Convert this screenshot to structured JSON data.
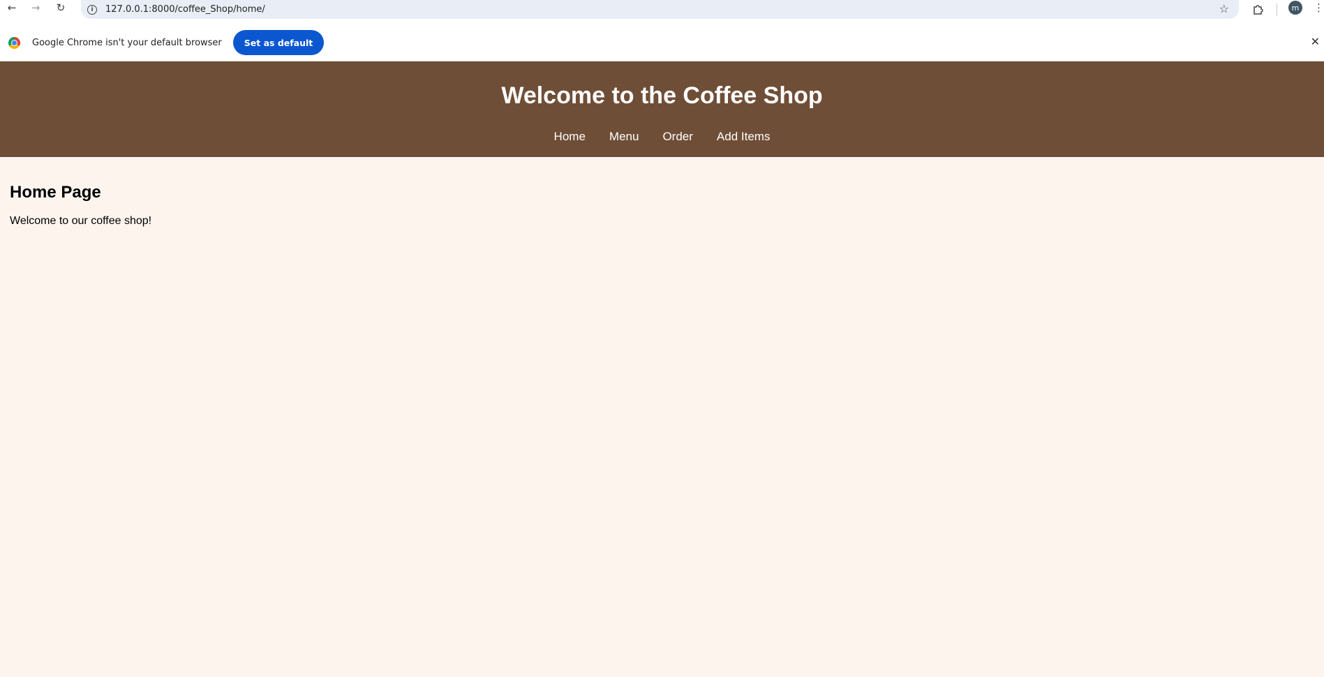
{
  "browser": {
    "url": "127.0.0.1:8000/coffee_Shop/home/",
    "profile_initial": "m",
    "icons": {
      "back": "arrow-left-icon",
      "forward": "arrow-right-icon",
      "reload": "reload-icon",
      "info": "info-icon",
      "bookmark": "star-icon",
      "extensions": "puzzle-icon",
      "menu": "kebab-icon"
    }
  },
  "infobar": {
    "message": "Google Chrome isn't your default browser",
    "button_label": "Set as default"
  },
  "site": {
    "title": "Welcome to the Coffee Shop",
    "nav": [
      "Home",
      "Menu",
      "Order",
      "Add Items"
    ],
    "colors": {
      "header_bg": "#6f4e37",
      "page_bg": "#fdf4ee",
      "button_blue": "#0b57d0"
    }
  },
  "main": {
    "heading": "Home Page",
    "text": "Welcome to our coffee shop!"
  }
}
